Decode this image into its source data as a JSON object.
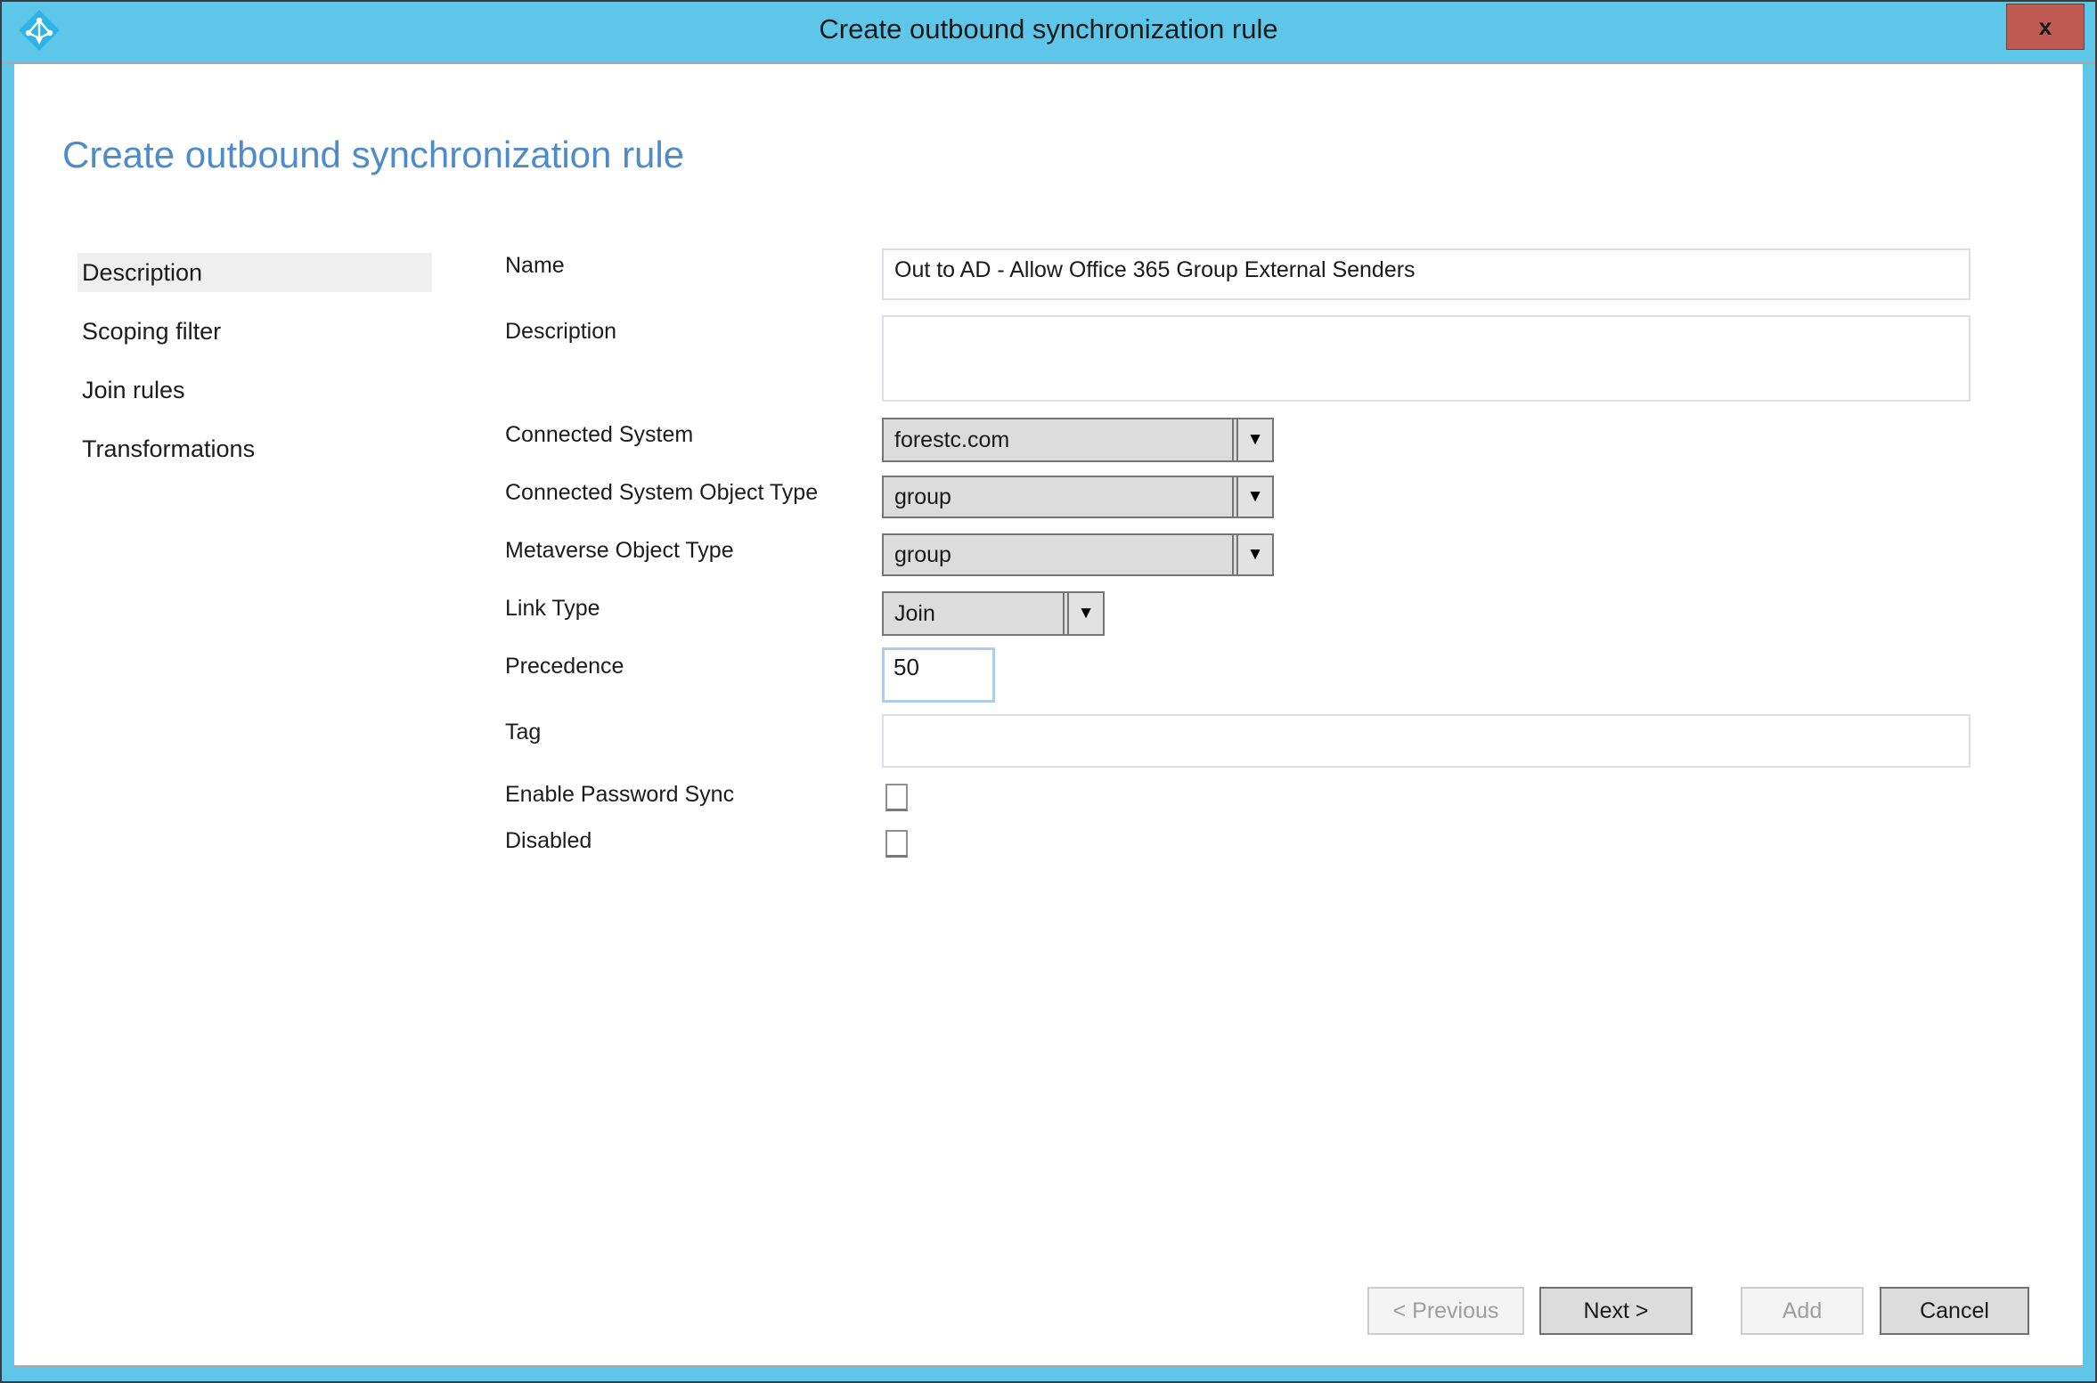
{
  "window": {
    "title": "Create outbound synchronization rule",
    "close_label": "x"
  },
  "page": {
    "heading": "Create outbound synchronization rule"
  },
  "sidebar": {
    "items": [
      {
        "label": "Description",
        "selected": true
      },
      {
        "label": "Scoping filter",
        "selected": false
      },
      {
        "label": "Join rules",
        "selected": false
      },
      {
        "label": "Transformations",
        "selected": false
      }
    ]
  },
  "form": {
    "name": {
      "label": "Name",
      "value": "Out to AD - Allow Office 365 Group External Senders"
    },
    "description": {
      "label": "Description",
      "value": ""
    },
    "connected_system": {
      "label": "Connected System",
      "value": "forestc.com"
    },
    "connected_system_object_type": {
      "label": "Connected System Object Type",
      "value": "group"
    },
    "metaverse_object_type": {
      "label": "Metaverse Object Type",
      "value": "group"
    },
    "link_type": {
      "label": "Link Type",
      "value": "Join"
    },
    "precedence": {
      "label": "Precedence",
      "value": "50"
    },
    "tag": {
      "label": "Tag",
      "value": ""
    },
    "enable_password_sync": {
      "label": "Enable Password Sync",
      "checked": false
    },
    "disabled": {
      "label": "Disabled",
      "checked": false
    }
  },
  "icons": {
    "dropdown_arrow": "▼"
  },
  "buttons": {
    "previous": {
      "label": "< Previous",
      "enabled": false
    },
    "next": {
      "label": "Next >",
      "enabled": true
    },
    "add": {
      "label": "Add",
      "enabled": false
    },
    "cancel": {
      "label": "Cancel",
      "enabled": true
    }
  },
  "colors": {
    "titlebar": "#5EC7E9",
    "close_button": "#BF5B52",
    "heading": "#4E8BC8",
    "selected_nav_bg": "#EFEFEF",
    "control_bg": "#DCDCDC",
    "control_border": "#757575",
    "input_border": "#DCDDE8",
    "precedence_border": "#AECBE8"
  }
}
